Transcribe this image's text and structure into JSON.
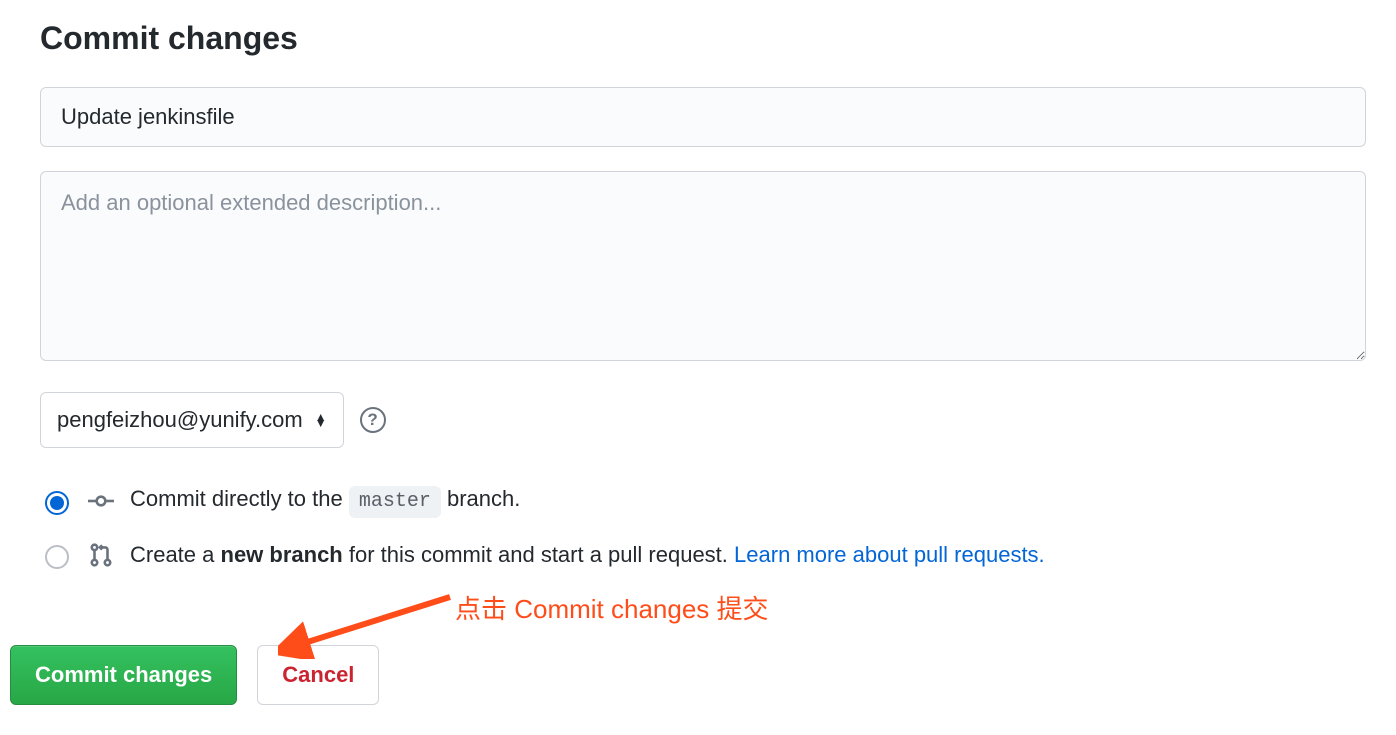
{
  "title": "Commit changes",
  "subject": {
    "value": "Update jenkinsfile"
  },
  "description": {
    "placeholder": "Add an optional extended description..."
  },
  "email": {
    "selected": "pengfeizhou@yunify.com"
  },
  "options": {
    "direct": {
      "prefix": "Commit directly to the ",
      "branch": "master",
      "suffix": " branch."
    },
    "newbranch": {
      "prefix": "Create a ",
      "strong": "new branch",
      "mid": " for this commit and start a pull request. ",
      "link": "Learn more about pull requests."
    }
  },
  "annotation": "点击 Commit changes 提交",
  "buttons": {
    "commit": "Commit changes",
    "cancel": "Cancel"
  }
}
